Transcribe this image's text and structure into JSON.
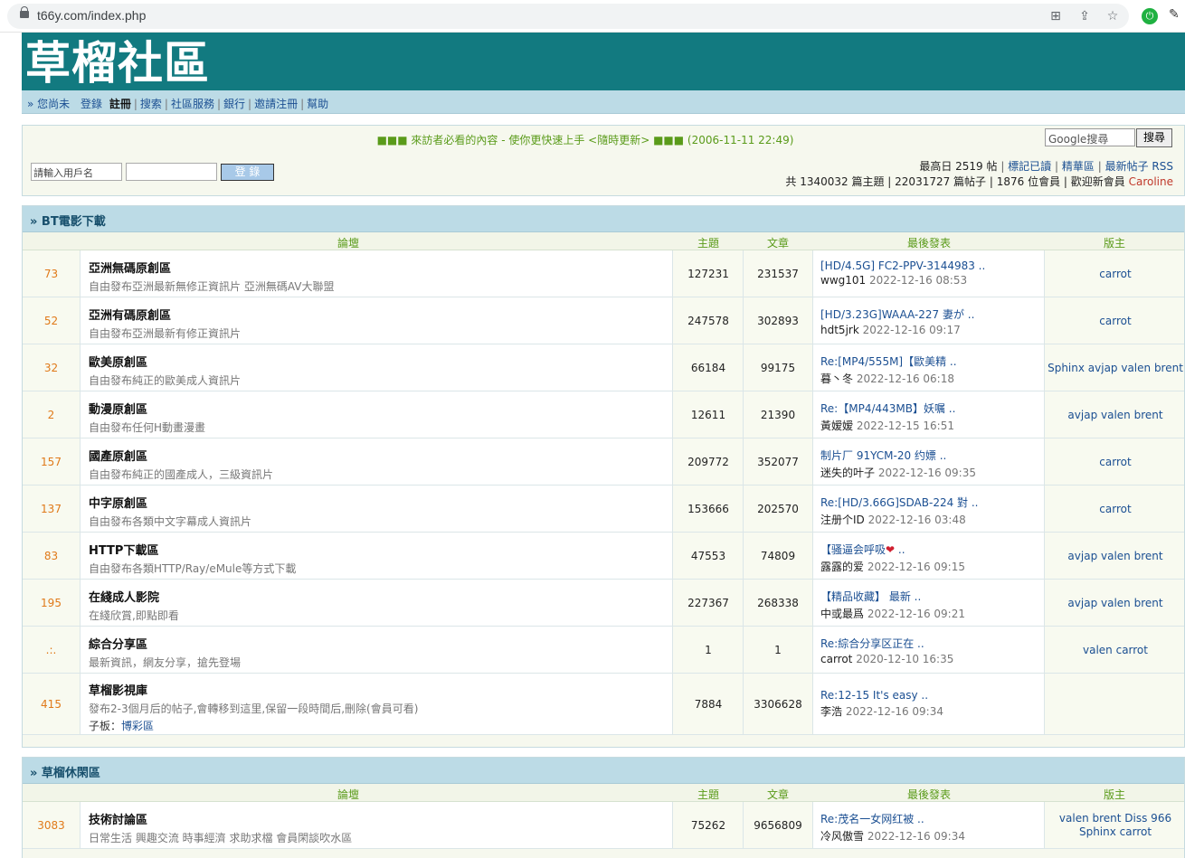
{
  "browser": {
    "url": "t66y.com/index.php"
  },
  "header": {
    "logo": "草榴社區"
  },
  "nav": {
    "greeting": "» 您尚未",
    "login": "登錄",
    "register": "註冊",
    "search": "搜索",
    "services": "社區服務",
    "bank": "銀行",
    "invite": "邀請注冊",
    "help": "幫助"
  },
  "info": {
    "notice": "■■■ 來訪者必看的內容 - 使你更快速上手 <隨時更新> ■■■ (2006-11-11 22:49)",
    "google_value": "Google搜尋",
    "google_btn": "搜尋",
    "user_placeholder": "請輸入用戶名",
    "login_btn": "登 錄",
    "peak": "最高日 2519 帖",
    "mark_read": "標記已讀",
    "digest": "精華區",
    "new_posts": "最新帖子",
    "rss": "RSS",
    "stats": "共 1340032 篇主題 | 22031727 篇帖子 | 1876 位會員 | 歡迎新會員",
    "new_member": "Caroline"
  },
  "columns": {
    "forum": "論壇",
    "topics": "主題",
    "posts": "文章",
    "last": "最後發表",
    "mods": "版主"
  },
  "sections": [
    {
      "title": "» BT電影下載",
      "rows": [
        {
          "count": "73",
          "name": "亞洲無碼原創區",
          "desc": "自由發布亞洲最新無修正資訊片 亞洲無碼AV大聯盟",
          "topics": "127231",
          "posts": "231537",
          "last_title": "[HD/4.5G] FC2-PPV-3144983 ..",
          "last_user": "wwg101",
          "last_time": "2022-12-16 08:53",
          "mods": "carrot"
        },
        {
          "count": "52",
          "name": "亞洲有碼原創區",
          "desc": "自由發布亞洲最新有修正資訊片",
          "topics": "247578",
          "posts": "302893",
          "last_title": "[HD/3.23G]WAAA-227 妻が ..",
          "last_user": "hdt5jrk",
          "last_time": "2022-12-16 09:17",
          "mods": "carrot"
        },
        {
          "count": "32",
          "name": "歐美原創區",
          "desc": "自由發布純正的歐美成人資訊片",
          "topics": "66184",
          "posts": "99175",
          "last_title": "Re:[MP4/555M]【歐美精 ..",
          "last_user": "暮丶冬",
          "last_time": "2022-12-16 06:18",
          "mods": "Sphinx avjap valen brent"
        },
        {
          "count": "2",
          "name": "動漫原創區",
          "desc": "自由發布任何H動畫漫畫",
          "topics": "12611",
          "posts": "21390",
          "last_title": "Re:【MP4/443MB】妖嘱 ..",
          "last_user": "黃嫒嫒",
          "last_time": "2022-12-15 16:51",
          "mods": "avjap valen brent"
        },
        {
          "count": "157",
          "name": "國產原創區",
          "desc": "自由發布純正的國產成人，三級資訊片",
          "topics": "209772",
          "posts": "352077",
          "last_title": "制片厂 91YCM-20 约嫖 ..",
          "last_user": "迷失的叶子",
          "last_time": "2022-12-16 09:35",
          "mods": "carrot"
        },
        {
          "count": "137",
          "name": "中字原創區",
          "desc": "自由發布各類中文字幕成人資訊片",
          "topics": "153666",
          "posts": "202570",
          "last_title": "Re:[HD/3.66G]SDAB-224 對 ..",
          "last_user": "注册个ID",
          "last_time": "2022-12-16 03:48",
          "mods": "carrot"
        },
        {
          "count": "83",
          "name": "HTTP下載區",
          "desc": "自由發布各類HTTP/Ray/eMule等方式下載",
          "topics": "47553",
          "posts": "74809",
          "last_title": "【骚逼会呼吸",
          "last_title_tail": " ..",
          "heart": true,
          "last_user": "露露的爱",
          "last_time": "2022-12-16 09:15",
          "mods": "avjap valen brent"
        },
        {
          "count": "195",
          "name": "在綫成人影院",
          "desc": "在綫欣賞,即點即看",
          "topics": "227367",
          "posts": "268338",
          "last_title": "【精品收藏】 最新 ..",
          "last_user": "中或最爲",
          "last_time": "2022-12-16 09:21",
          "mods": "avjap valen brent"
        },
        {
          "count": ".:.",
          "name": "綜合分享區",
          "desc": "最新資訊，網友分享，搶先登場",
          "topics": "1",
          "posts": "1",
          "last_title": "Re:綜合分享区正在 ..",
          "last_user": "carrot",
          "last_time": "2020-12-10 16:35",
          "mods": "valen carrot"
        },
        {
          "count": "415",
          "name": "草榴影視庫",
          "desc": "發布2-3個月后的帖子,會轉移到這里,保留一段時間后,刪除(會員可看)",
          "sub_label": "子板：",
          "sub_link": "博彩區",
          "topics": "7884",
          "posts": "3306628",
          "last_title": "Re:12-15  It's easy ..",
          "last_user": "李浩",
          "last_time": "2022-12-16 09:34",
          "mods": ""
        }
      ]
    },
    {
      "title": "» 草榴休閑區",
      "rows": [
        {
          "count": "3083",
          "name": "技術討論區",
          "desc": "日常生活 興趣交流 時事經濟 求助求檔 會員閑談吹水區",
          "topics": "75262",
          "posts": "9656809",
          "last_title": "Re:茂名一女网红被 ..",
          "last_user": "冷风傲雪",
          "last_time": "2022-12-16 09:34",
          "mods": "valen brent Diss 966",
          "mods2": "Sphinx carrot"
        }
      ]
    }
  ]
}
